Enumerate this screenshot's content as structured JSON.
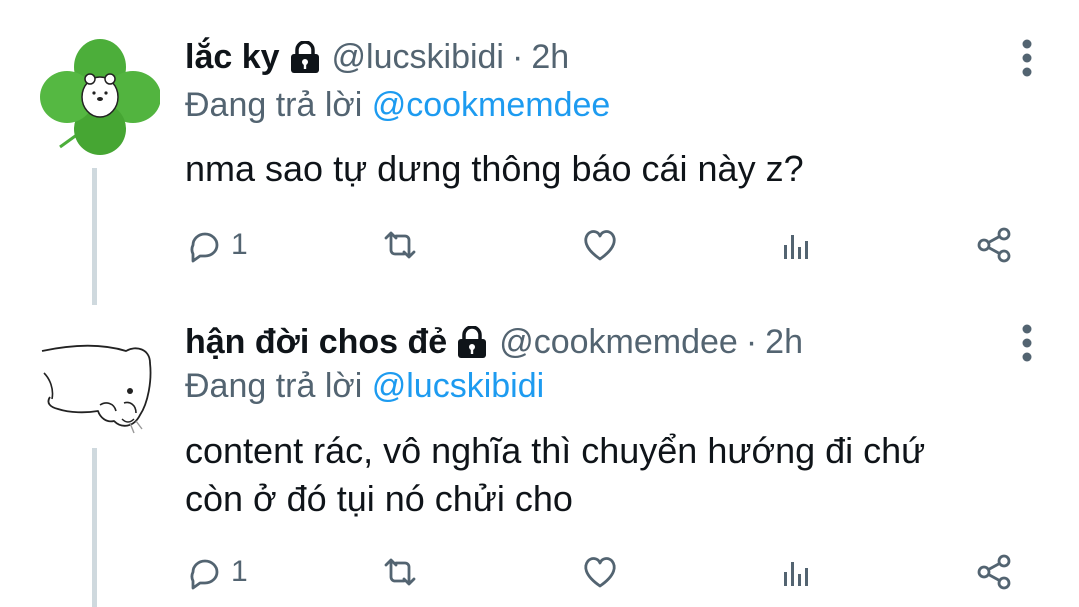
{
  "tweets": [
    {
      "name": "lắc ky",
      "handle": "@lucskibidi",
      "time": "2h",
      "replying_prefix": "Đang trả lời",
      "replying_to": "@cookmemdee",
      "text": "nma sao tự dưng thông báo cái này z?",
      "reply_count": "1",
      "avatar": "clover-bear-avatar",
      "icons": [
        "lock-icon",
        "more-vertical-icon",
        "reply-icon",
        "retweet-icon",
        "like-icon",
        "views-icon",
        "share-icon"
      ]
    },
    {
      "name": "hận đời chos đẻ",
      "handle": "@cookmemdee",
      "time": "2h",
      "replying_prefix": "Đang trả lời",
      "replying_to": "@lucskibidi",
      "text_line1": "content rác, vô nghĩa thì chuyển hướng đi chứ",
      "text_line2": "còn ở đó tụi nó chửi cho",
      "reply_count": "1",
      "avatar": "sketch-dog-avatar",
      "icons": [
        "lock-icon",
        "more-vertical-icon",
        "reply-icon",
        "retweet-icon",
        "like-icon",
        "views-icon",
        "share-icon"
      ]
    }
  ],
  "colors": {
    "text": "#0f1419",
    "muted": "#536471",
    "mention": "#1d9bf0",
    "line": "#cfd9de",
    "clover": "#4cae3a"
  }
}
